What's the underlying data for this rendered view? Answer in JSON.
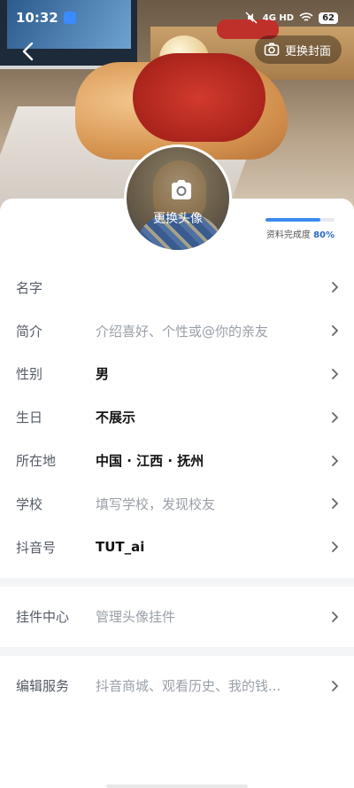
{
  "status_bar": {
    "time": "10:32",
    "network": "4G HD",
    "battery": "62"
  },
  "header": {
    "change_cover_label": "更换封面"
  },
  "avatar": {
    "change_label": "更换头像"
  },
  "profile_completion": {
    "label": "资料完成度",
    "percent_text": "80%",
    "fraction": 0.8
  },
  "fields": [
    {
      "label": "名字",
      "value": "",
      "placeholder": false
    },
    {
      "label": "简介",
      "value": "介绍喜好、个性或@你的亲友",
      "placeholder": true
    },
    {
      "label": "性别",
      "value": "男",
      "placeholder": false
    },
    {
      "label": "生日",
      "value": "不展示",
      "placeholder": false
    },
    {
      "label": "所在地",
      "value": "中国 · 江西 · 抚州",
      "placeholder": false
    },
    {
      "label": "学校",
      "value": "填写学校，发现校友",
      "placeholder": true
    },
    {
      "label": "抖音号",
      "value": "TUT_ai",
      "placeholder": false
    }
  ],
  "widget_center": {
    "label": "挂件中心",
    "value": "管理头像挂件"
  },
  "edit_service": {
    "label": "编辑服务",
    "value": "抖音商城、观看历史、我的钱..."
  },
  "colors": {
    "accent": "#3b8bf0",
    "label_gray": "#555b66",
    "placeholder_gray": "#9aa0a8"
  }
}
